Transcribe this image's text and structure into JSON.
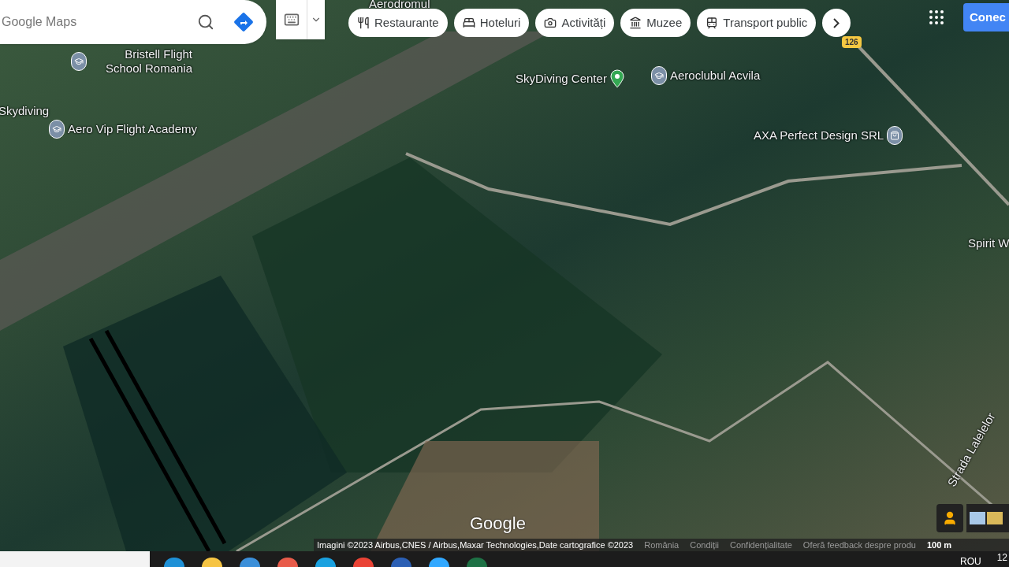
{
  "search": {
    "placeholder": "Google Maps"
  },
  "chips": [
    {
      "label": "Restaurante",
      "kind": "restaurant"
    },
    {
      "label": "Hoteluri",
      "kind": "hotel"
    },
    {
      "label": "Activități",
      "kind": "camera"
    },
    {
      "label": "Muzee",
      "kind": "museum"
    },
    {
      "label": "Transport public",
      "kind": "transit"
    }
  ],
  "sign_in": "Conec",
  "map_labels": [
    {
      "text": "Aerodromul",
      "kind": "plain"
    },
    {
      "text": "Bristell Flight School Romania",
      "kind": "school"
    },
    {
      "text": "Skydiving",
      "kind": "plain"
    },
    {
      "text": "Aero Vip Flight Academy",
      "kind": "school"
    },
    {
      "text": "SkyDiving Center",
      "kind": "green"
    },
    {
      "text": "Aeroclubul Acvila",
      "kind": "school"
    },
    {
      "text": "AXA Perfect Design SRL",
      "kind": "shop"
    },
    {
      "text": "Spirit W",
      "kind": "plain"
    },
    {
      "text": "Strada Lalelelor",
      "kind": "street"
    },
    {
      "text": "126",
      "kind": "road"
    }
  ],
  "logo": "Google",
  "attribution": {
    "imagery": "Imagini ©2023 Airbus,CNES / Airbus,Maxar Technologies,Date cartografice ©2023",
    "links": [
      "România",
      "Condiții",
      "Confidențialitate",
      "Oferă feedback despre produ"
    ],
    "scale": "100 m"
  },
  "taskbar": {
    "language": "ROU",
    "clock": "12"
  }
}
